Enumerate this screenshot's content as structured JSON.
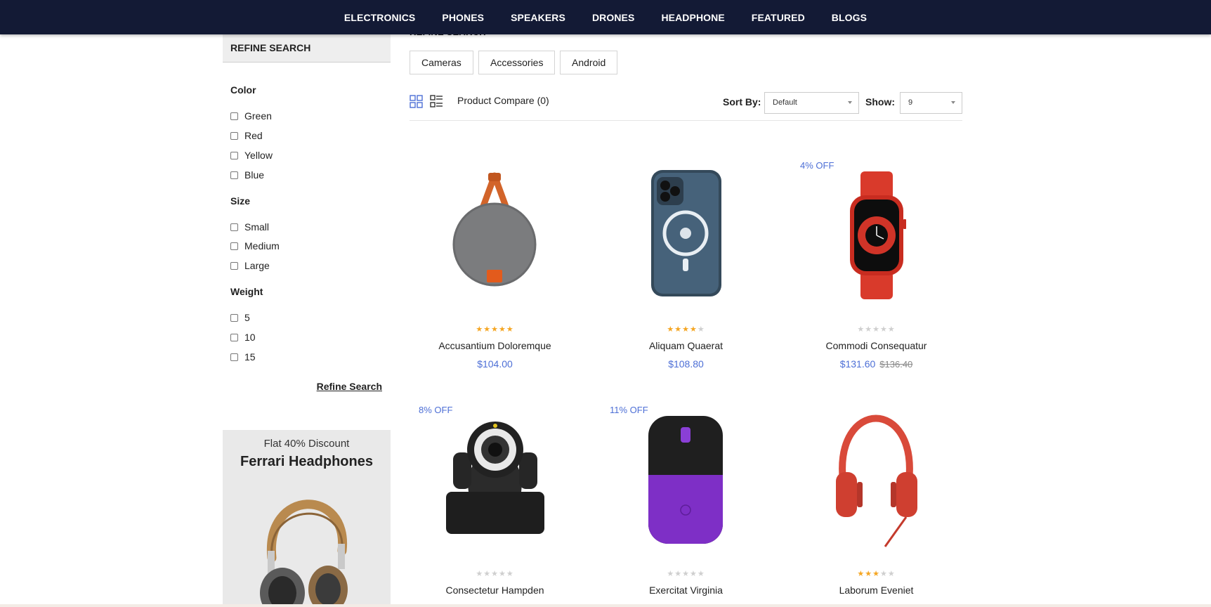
{
  "nav": {
    "items": [
      "ELECTRONICS",
      "PHONES",
      "SPEAKERS",
      "DRONES",
      "HEADPHONE",
      "FEATURED",
      "BLOGS"
    ]
  },
  "page_heading": "REFINE SEARCH",
  "sidebar": {
    "title": "REFINE SEARCH",
    "groups": [
      {
        "title": "Color",
        "options": [
          "Green",
          "Red",
          "Yellow",
          "Blue"
        ]
      },
      {
        "title": "Size",
        "options": [
          "Small",
          "Medium",
          "Large"
        ]
      },
      {
        "title": "Weight",
        "options": [
          "5",
          "10",
          "15"
        ]
      }
    ],
    "refine_link": "Refine Search",
    "promo": {
      "subtitle": "Flat 40% Discount",
      "title": "Ferrari Headphones"
    }
  },
  "categories": [
    "Cameras",
    "Accessories",
    "Android"
  ],
  "toolbar": {
    "compare": "Product Compare (0)",
    "sort_label": "Sort By:",
    "sort_value": "Default",
    "show_label": "Show:",
    "show_value": "9"
  },
  "colors": {
    "nav_bg": "#131a35",
    "accent": "#4d6fd6",
    "star": "#f5a623"
  },
  "products": [
    {
      "name": "Accusantium Doloremque",
      "price": "$104.00",
      "old_price": "",
      "discount": "",
      "rating": 5,
      "image": "speaker-icon"
    },
    {
      "name": "Aliquam Quaerat",
      "price": "$108.80",
      "old_price": "",
      "discount": "",
      "rating": 4,
      "image": "phone-icon"
    },
    {
      "name": "Commodi Consequatur",
      "price": "$131.60",
      "old_price": "$136.40",
      "discount": "4% OFF",
      "rating": 0,
      "image": "watch-icon"
    },
    {
      "name": "Consectetur Hampden",
      "price": "",
      "old_price": "",
      "discount": "8% OFF",
      "rating": 0,
      "image": "camera-icon"
    },
    {
      "name": "Exercitat Virginia",
      "price": "",
      "old_price": "",
      "discount": "11% OFF",
      "rating": 0,
      "image": "mouse-icon"
    },
    {
      "name": "Laborum Eveniet",
      "price": "",
      "old_price": "",
      "discount": "",
      "rating": 3,
      "image": "headphones-icon"
    }
  ]
}
